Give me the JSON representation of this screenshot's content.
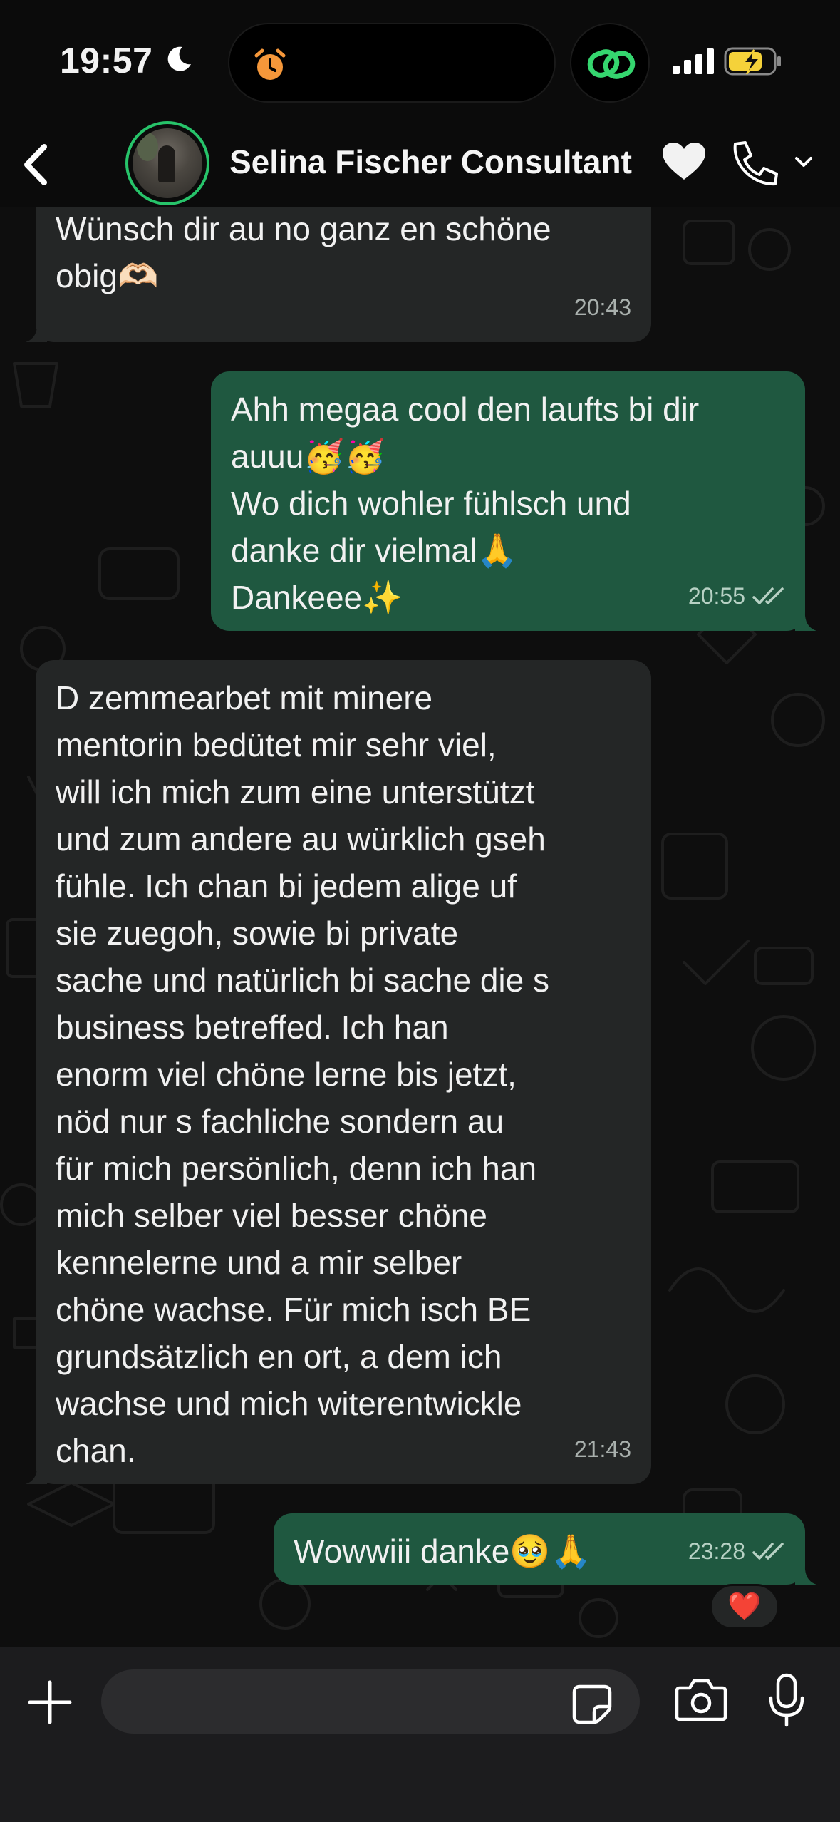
{
  "status_bar": {
    "time": "19:57"
  },
  "header": {
    "contact_name": "Selina Fischer Consultant",
    "name_emoji": "🤍"
  },
  "messages": [
    {
      "direction": "in",
      "text": "schwizerdütsch?\nWünsch dir au no ganz en schöne\nobig🫶🏻",
      "time": "20:43"
    },
    {
      "direction": "out",
      "text": "Ahh megaa cool den laufts bi dir\nauuu🥳🥳\nWo dich wohler fühlsch und\ndanke dir vielmal🙏\nDankeee✨",
      "time": "20:55",
      "status": "read"
    },
    {
      "direction": "in",
      "text": "D zemmearbet mit minere\nmentorin bedütet mir sehr viel,\nwill ich mich zum eine unterstützt\nund zum andere au würklich gseh\nfühle. Ich chan bi jedem alige uf\nsie zuegoh, sowie bi private\nsache und natürlich bi sache die s\nbusiness betreffed. Ich han\nenorm viel chöne lerne bis jetzt,\nnöd nur s fachliche sondern au\nfür mich persönlich, denn ich han\nmich selber viel besser chöne\nkennelerne und a mir selber\nchöne wachse. Für mich isch BE\ngrundsätzlich en ort, a dem ich\nwachse und mich witerentwickle\nchan.",
      "time": "21:43"
    },
    {
      "direction": "out",
      "text": "Wowwiii danke🥹🙏",
      "time": "23:28",
      "status": "read",
      "reaction": "❤️"
    }
  ],
  "colors": {
    "incoming_bubble": "#242626",
    "outgoing_bubble": "#1f5840",
    "accent_green": "#27c46a",
    "background": "#0e0e0e"
  },
  "icons": [
    "moon-icon",
    "alarm-icon",
    "link-icon",
    "signal-icon",
    "battery-charging-icon",
    "back-icon",
    "phone-icon",
    "chevron-down-icon",
    "double-check-icon",
    "plus-icon",
    "sticker-icon",
    "camera-icon",
    "microphone-icon"
  ]
}
